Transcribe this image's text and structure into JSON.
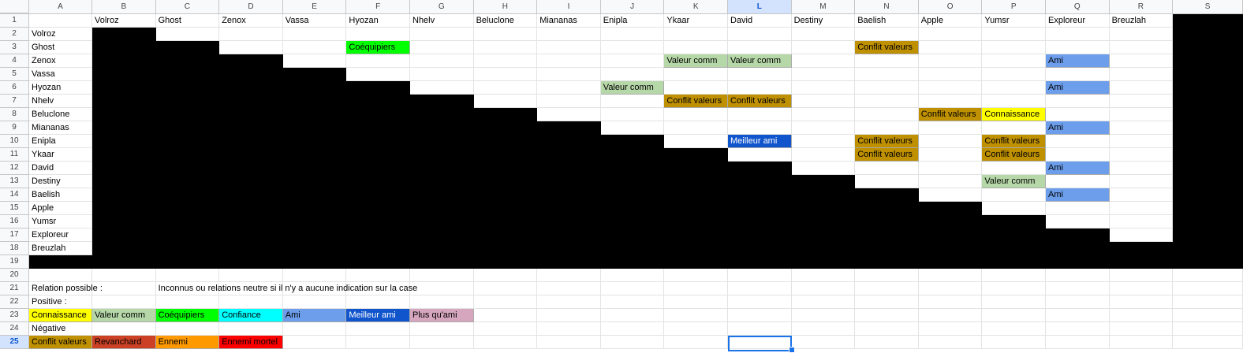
{
  "columns": [
    "A",
    "B",
    "C",
    "D",
    "E",
    "F",
    "G",
    "H",
    "I",
    "J",
    "K",
    "L",
    "M",
    "N",
    "O",
    "P",
    "Q",
    "R",
    "S"
  ],
  "rows": [
    "1",
    "2",
    "3",
    "4",
    "5",
    "6",
    "7",
    "8",
    "9",
    "10",
    "11",
    "12",
    "13",
    "14",
    "15",
    "16",
    "17",
    "18",
    "19",
    "20",
    "21",
    "22",
    "23",
    "24",
    "25"
  ],
  "selected": {
    "column": "L",
    "row": "25"
  },
  "people": [
    "Volroz",
    "Ghost",
    "Zenox",
    "Vassa",
    "Hyozan",
    "Nhelv",
    "Beluclone",
    "Miananas",
    "Enipla",
    "Ykaar",
    "David",
    "Destiny",
    "Baelish",
    "Apple",
    "Yumsr",
    "Exploreur",
    "Breuzlah"
  ],
  "relations": [
    {
      "row": 3,
      "col": 5,
      "text": "Coéquipiers",
      "type": "coequipiers"
    },
    {
      "row": 3,
      "col": 13,
      "text": "Conflit valeurs",
      "type": "conflit"
    },
    {
      "row": 4,
      "col": 10,
      "text": "Valeur comm",
      "type": "valeur"
    },
    {
      "row": 4,
      "col": 11,
      "text": "Valeur comm",
      "type": "valeur"
    },
    {
      "row": 4,
      "col": 16,
      "text": "Ami",
      "type": "ami"
    },
    {
      "row": 6,
      "col": 9,
      "text": "Valeur comm",
      "type": "valeur"
    },
    {
      "row": 6,
      "col": 16,
      "text": "Ami",
      "type": "ami"
    },
    {
      "row": 7,
      "col": 10,
      "text": "Conflit valeurs",
      "type": "conflit"
    },
    {
      "row": 7,
      "col": 11,
      "text": "Conflit valeurs",
      "type": "conflit"
    },
    {
      "row": 8,
      "col": 14,
      "text": "Conflit valeurs",
      "type": "conflit"
    },
    {
      "row": 8,
      "col": 15,
      "text": "Connaissance",
      "type": "connaissance"
    },
    {
      "row": 9,
      "col": 16,
      "text": "Ami",
      "type": "ami"
    },
    {
      "row": 10,
      "col": 11,
      "text": "Meilleur ami",
      "type": "meilleur"
    },
    {
      "row": 10,
      "col": 13,
      "text": "Conflit valeurs",
      "type": "conflit"
    },
    {
      "row": 10,
      "col": 15,
      "text": "Conflit valeurs",
      "type": "conflit"
    },
    {
      "row": 11,
      "col": 13,
      "text": "Conflit valeurs",
      "type": "conflit"
    },
    {
      "row": 11,
      "col": 15,
      "text": "Conflit valeurs",
      "type": "conflit"
    },
    {
      "row": 12,
      "col": 16,
      "text": "Ami",
      "type": "ami"
    },
    {
      "row": 13,
      "col": 15,
      "text": "Valeur comm",
      "type": "valeur"
    },
    {
      "row": 14,
      "col": 16,
      "text": "Ami",
      "type": "ami"
    }
  ],
  "legend": {
    "possible_label": "Relation possible :",
    "neutral_note": "Inconnus ou relations neutre si il n'y a aucune indication sur la case",
    "positive_label": "Positive :",
    "negative_label": "Négative",
    "positive": [
      {
        "text": "Connaissance",
        "type": "connaissance"
      },
      {
        "text": "Valeur comm",
        "type": "valeur"
      },
      {
        "text": "Coéquipiers",
        "type": "coequipiers"
      },
      {
        "text": "Confiance",
        "type": "confiance"
      },
      {
        "text": "Ami",
        "type": "ami"
      },
      {
        "text": "Meilleur ami",
        "type": "meilleur"
      },
      {
        "text": "Plus qu'ami",
        "type": "plusquami"
      }
    ],
    "negative": [
      {
        "text": "Conflit valeurs",
        "type": "conflit"
      },
      {
        "text": "Revanchard",
        "type": "revanchard"
      },
      {
        "text": "Ennemi",
        "type": "ennemi"
      },
      {
        "text": "Ennemi mortel",
        "type": "ennemimortel"
      }
    ]
  },
  "colors": {
    "connaissance": "#ffff00",
    "valeur": "#b6d7a8",
    "coequipiers": "#00ff00",
    "confiance": "#00ffff",
    "ami": "#6d9eeb",
    "meilleur": "#1155cc",
    "plusquami": "#d5a6bd",
    "conflit": "#bf9000",
    "revanchard": "#cc4125",
    "ennemi": "#ff9900",
    "ennemimortel": "#ff0000",
    "black": "#000000",
    "selection": "#1a73e8"
  }
}
